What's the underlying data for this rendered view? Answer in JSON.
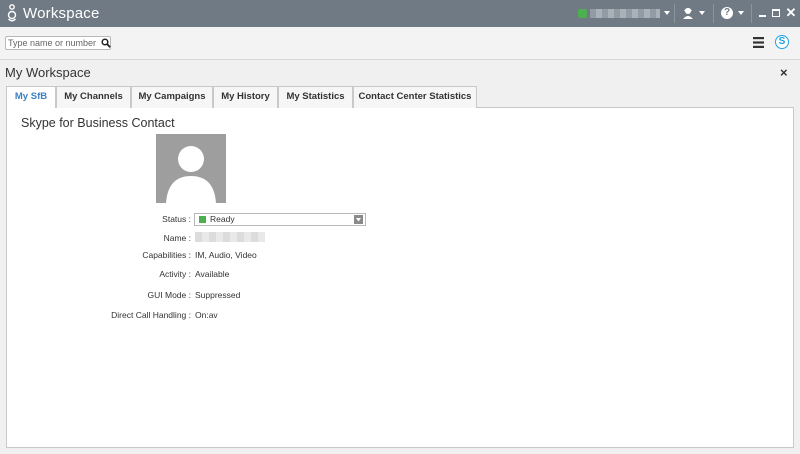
{
  "titlebar": {
    "title": "Workspace",
    "logo_icon": "genesys-logo-icon",
    "status_color": "#4caf50",
    "agent_icon": "agent-headset-icon",
    "help_icon": "help-icon",
    "help_glyph": "?",
    "close_glyph": "✕"
  },
  "toolbar": {
    "search_placeholder": "Type name or number",
    "search_icon": "search-icon",
    "menu_icon": "hamburger-menu-icon",
    "skype_icon": "skype-icon",
    "skype_glyph": "S",
    "skype_color": "#1ea1e4"
  },
  "workspace": {
    "title": "My Workspace",
    "close_glyph": "×"
  },
  "tabs": [
    {
      "label": "My SfB",
      "active": true
    },
    {
      "label": "My Channels"
    },
    {
      "label": "My Campaigns"
    },
    {
      "label": "My History"
    },
    {
      "label": "My Statistics"
    },
    {
      "label": "Contact Center Statistics"
    }
  ],
  "contact": {
    "title": "Skype for Business Contact",
    "fields": {
      "status_label": "Status :",
      "status_value": "Ready",
      "status_color": "#4caf50",
      "name_label": "Name :",
      "capabilities_label": "Capabilities :",
      "capabilities_value": "IM, Audio, Video",
      "activity_label": "Activity :",
      "activity_value": "Available",
      "gui_mode_label": "GUI Mode :",
      "gui_mode_value": "Suppressed",
      "direct_call_label": "Direct Call Handling :",
      "direct_call_value": "On:av"
    }
  },
  "colors": {
    "titlebar_bg": "#6f7a84",
    "active_tab": "#3c7fc0"
  }
}
